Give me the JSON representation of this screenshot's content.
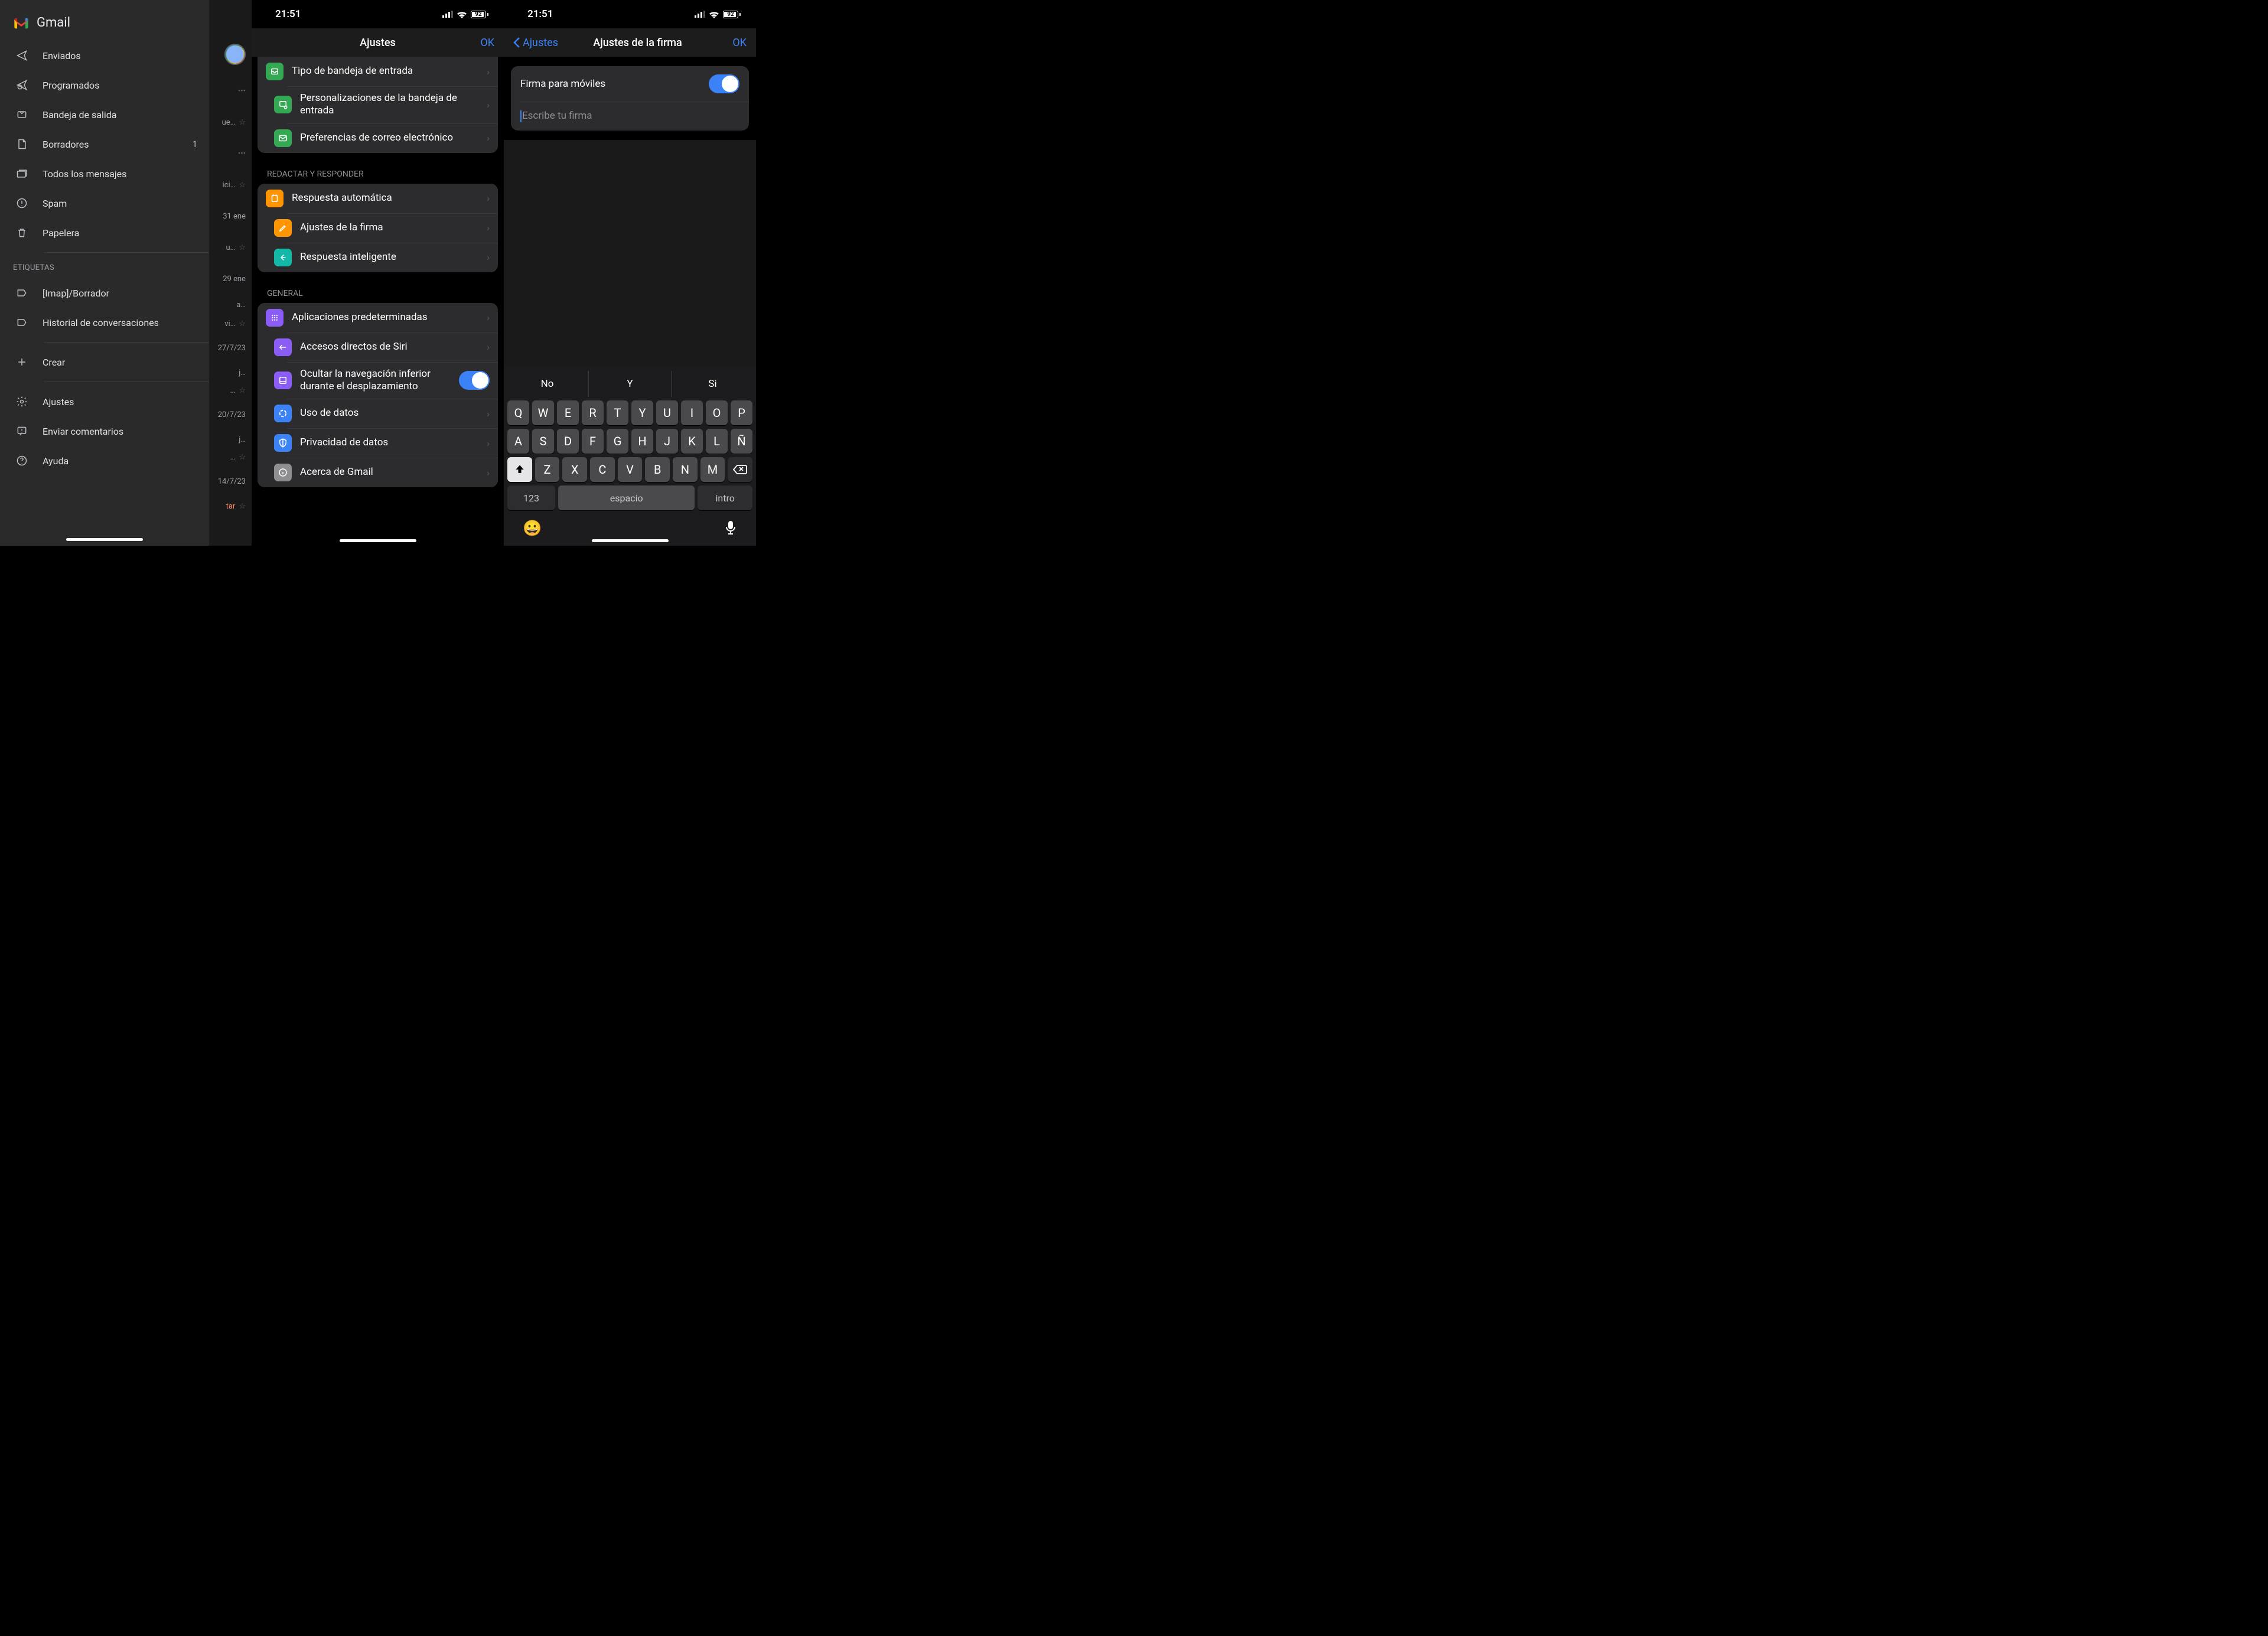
{
  "panel1": {
    "app_title": "Gmail",
    "items": [
      {
        "icon": "send",
        "label": "Enviados",
        "count": ""
      },
      {
        "icon": "scheduled",
        "label": "Programados",
        "count": ""
      },
      {
        "icon": "outbox",
        "label": "Bandeja de salida",
        "count": ""
      },
      {
        "icon": "drafts",
        "label": "Borradores",
        "count": "1"
      },
      {
        "icon": "allmail",
        "label": "Todos los mensajes",
        "count": ""
      },
      {
        "icon": "spam",
        "label": "Spam",
        "count": ""
      },
      {
        "icon": "trash",
        "label": "Papelera",
        "count": ""
      }
    ],
    "labels_heading": "ETIQUETAS",
    "labels": [
      {
        "icon": "label",
        "label": "[Imap]/Borrador"
      },
      {
        "icon": "label",
        "label": "Historial de conversaciones"
      }
    ],
    "create": {
      "icon": "plus",
      "label": "Crear"
    },
    "footer": [
      {
        "icon": "gear",
        "label": "Ajustes"
      },
      {
        "icon": "feedback",
        "label": "Enviar comentarios"
      },
      {
        "icon": "help",
        "label": "Ayuda"
      }
    ],
    "bg_dates": [
      "",
      "31 ene",
      "",
      "29 ene",
      "",
      "27/7/23",
      "",
      "20/7/23",
      "",
      "14/7/23"
    ]
  },
  "panel2": {
    "time": "21:51",
    "battery": "92",
    "nav_title": "Ajustes",
    "nav_ok": "OK",
    "group1": [
      {
        "color": "ic-green",
        "icon": "inbox-type",
        "label": "Tipo de bandeja de entrada"
      },
      {
        "color": "ic-green",
        "icon": "inbox-custom",
        "label": "Personalizaciones de la bandeja de entrada"
      },
      {
        "color": "ic-green",
        "icon": "mail-pref",
        "label": "Preferencias de correo electrónico"
      }
    ],
    "head2": "REDACTAR Y RESPONDER",
    "group2": [
      {
        "color": "ic-orange",
        "icon": "vacation",
        "label": "Respuesta automática"
      },
      {
        "color": "ic-orange",
        "icon": "signature",
        "label": "Ajustes de la firma"
      },
      {
        "color": "ic-teal",
        "icon": "smartreply",
        "label": "Respuesta inteligente"
      }
    ],
    "head3": "GENERAL",
    "group3": [
      {
        "color": "ic-purple",
        "icon": "apps",
        "label": "Aplicaciones predeterminadas",
        "chev": true
      },
      {
        "color": "ic-purple",
        "icon": "siri",
        "label": "Accesos directos de Siri",
        "chev": true
      },
      {
        "color": "ic-purple",
        "icon": "nav",
        "label": "Ocultar la navegación inferior durante el desplazamiento",
        "toggle": true
      },
      {
        "color": "ic-blue",
        "icon": "data",
        "label": "Uso de datos",
        "chev": true
      },
      {
        "color": "ic-blue",
        "icon": "privacy",
        "label": "Privacidad de datos",
        "chev": true
      },
      {
        "color": "ic-gray",
        "icon": "about",
        "label": "Acerca de Gmail",
        "chev": true
      }
    ]
  },
  "panel3": {
    "time": "21:51",
    "battery": "92",
    "back": "Ajustes",
    "nav_title": "Ajustes de la firma",
    "nav_ok": "OK",
    "toggle_label": "Firma para móviles",
    "placeholder": "Escribe tu firma",
    "suggestions": [
      "No",
      "Y",
      "Si"
    ],
    "row1": [
      "Q",
      "W",
      "E",
      "R",
      "T",
      "Y",
      "U",
      "I",
      "O",
      "P"
    ],
    "row2": [
      "A",
      "S",
      "D",
      "F",
      "G",
      "H",
      "J",
      "K",
      "L",
      "Ñ"
    ],
    "row3": [
      "Z",
      "X",
      "C",
      "V",
      "B",
      "N",
      "M"
    ],
    "key_123": "123",
    "key_space": "espacio",
    "key_return": "intro"
  }
}
